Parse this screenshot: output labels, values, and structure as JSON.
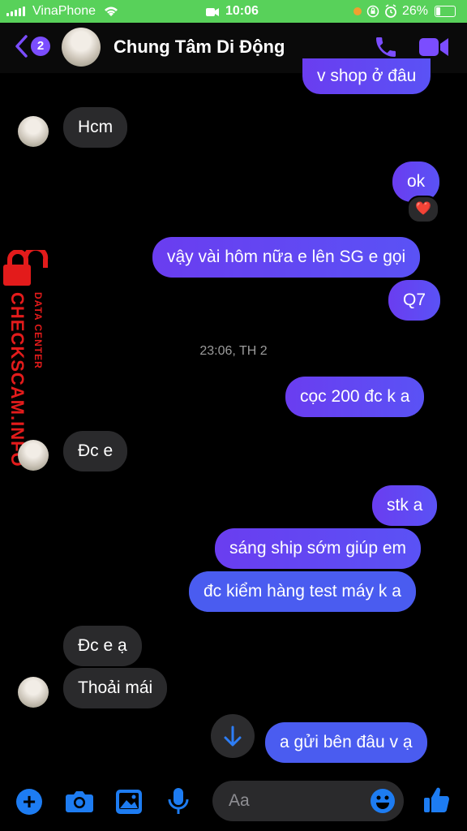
{
  "status_bar": {
    "carrier": "VinaPhone",
    "time": "10:06",
    "battery": "26%",
    "battery_level": 0.26
  },
  "header": {
    "unread_count": "2",
    "contact_name": "Chung Tâm Di Động"
  },
  "watermark": {
    "main": "CHECKSCAM.INFO",
    "sub": "DATA CENTER"
  },
  "messages": {
    "m0": "v shop ở đâu",
    "m1": "Hcm",
    "m2": "ok",
    "m2_reaction": "❤️",
    "m3": "vậy vài hôm nữa e lên SG e gọi",
    "m4": "Q7",
    "timestamp": "23:06, TH 2",
    "m5": "cọc 200 đc k a",
    "m6": "Đc e",
    "m7": "stk a",
    "m8": "sáng ship sớm giúp em",
    "m9": "đc kiểm hàng test máy k a",
    "m10": "Đc e ạ",
    "m11": "Thoải mái",
    "m12": "a gửi bên đâu v ạ"
  },
  "composer": {
    "placeholder": "Aa"
  },
  "colors": {
    "accent": "#7b4dff",
    "incoming_bubble": "#2a2a2c",
    "status_bar": "#58d15a",
    "watermark": "#e31b1b"
  }
}
